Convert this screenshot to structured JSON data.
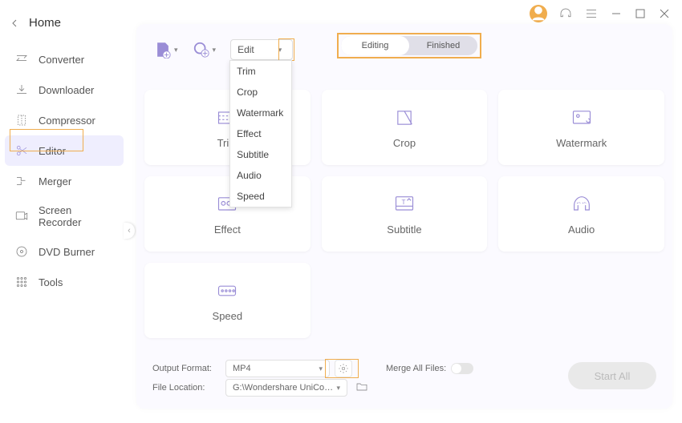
{
  "titlebar": {
    "avatar": "user"
  },
  "sidebar": {
    "home": "Home",
    "items": [
      {
        "icon": "converter",
        "label": "Converter"
      },
      {
        "icon": "download",
        "label": "Downloader"
      },
      {
        "icon": "compress",
        "label": "Compressor"
      },
      {
        "icon": "scissors",
        "label": "Editor"
      },
      {
        "icon": "merge",
        "label": "Merger"
      },
      {
        "icon": "rec",
        "label": "Screen Recorder"
      },
      {
        "icon": "disc",
        "label": "DVD Burner"
      },
      {
        "icon": "grid",
        "label": "Tools"
      }
    ],
    "active_index": 3
  },
  "toolbar": {
    "dropdown_label": "Edit",
    "dropdown_items": [
      "Trim",
      "Crop",
      "Watermark",
      "Effect",
      "Subtitle",
      "Audio",
      "Speed"
    ]
  },
  "segment": {
    "active": "Editing",
    "inactive": "Finished"
  },
  "tiles": [
    "Trim",
    "Crop",
    "Watermark",
    "Effect",
    "Subtitle",
    "Audio",
    "Speed"
  ],
  "bottom": {
    "format_label": "Output Format:",
    "format_value": "MP4",
    "location_label": "File Location:",
    "location_value": "G:\\Wondershare UniConverter",
    "merge_label": "Merge All Files:",
    "start_label": "Start All"
  }
}
